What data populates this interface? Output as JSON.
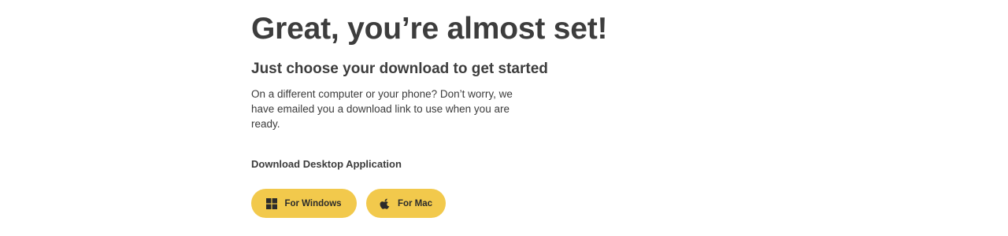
{
  "hero": {
    "headline": "Great, you’re almost set!",
    "subheadline": "Just choose your download to get started",
    "body": "On a different computer or your phone? Don’t worry, we have emailed you a download link to use when you are ready."
  },
  "downloads": {
    "section_label": "Download Desktop Application",
    "buttons": [
      {
        "label": "For Windows",
        "icon": "windows-icon"
      },
      {
        "label": "For Mac",
        "icon": "apple-icon"
      }
    ]
  },
  "colors": {
    "button_bg": "#f2c94c",
    "text": "#3d3d3d",
    "background": "#ffffff"
  }
}
